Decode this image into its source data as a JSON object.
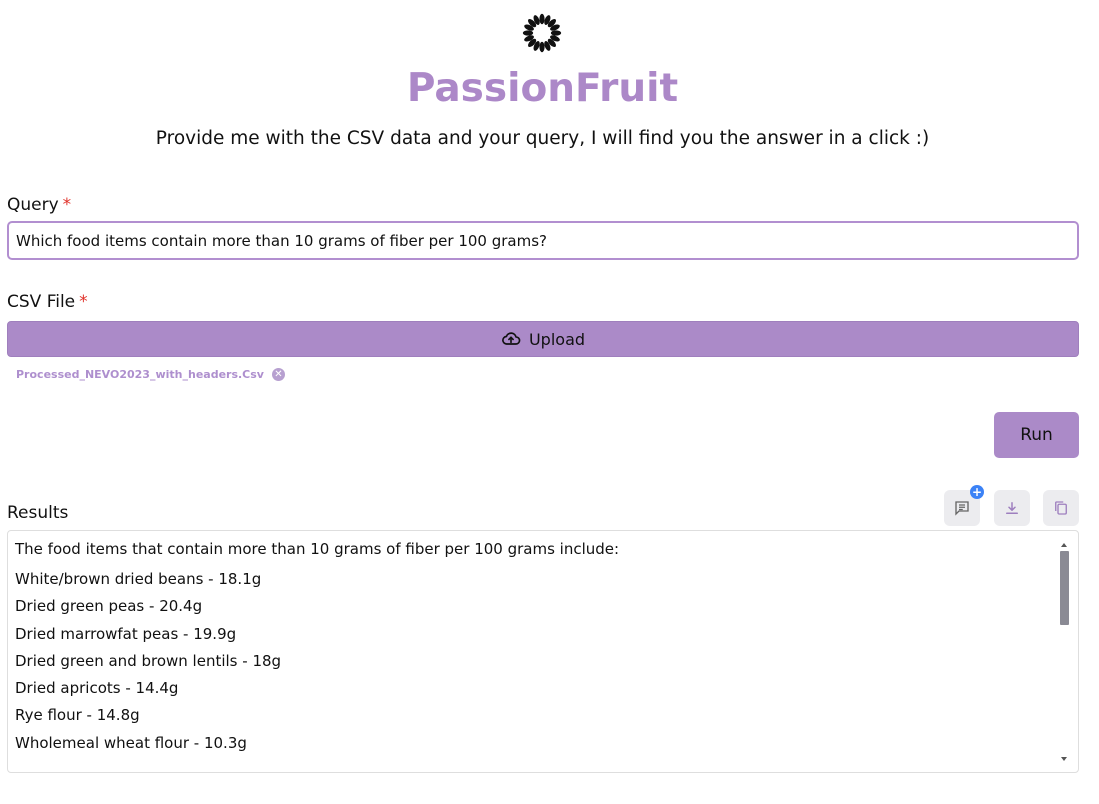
{
  "app": {
    "title": "PassionFruit",
    "subtitle": "Provide me with the CSV data and your query, I will find you the answer in a click :)",
    "logo_icon": "sunburst-logo-icon",
    "accent_color": "#ab8ac8"
  },
  "query": {
    "label": "Query",
    "required_mark": "*",
    "value": "Which food items contain more than 10 grams of fiber per 100 grams?"
  },
  "csv": {
    "label": "CSV File",
    "required_mark": "*",
    "upload_label": "Upload",
    "upload_icon": "cloud-upload-icon",
    "file_name": "Processed_NEVO2023_with_headers.Csv",
    "remove_icon": "close-circle-icon"
  },
  "run": {
    "label": "Run"
  },
  "results": {
    "label": "Results",
    "actions": [
      "comment-icon",
      "download-icon",
      "copy-icon"
    ],
    "badge": "+",
    "intro": "The food items that contain more than 10 grams of fiber per 100 grams include:",
    "lines": [
      "White/brown dried beans - 18.1g",
      "Dried green peas - 20.4g",
      "Dried marrowfat peas - 19.9g",
      "Dried green and brown lentils - 18g",
      "Dried apricots - 14.4g",
      "Rye flour - 14.8g",
      "Wholemeal wheat flour - 10.3g"
    ]
  }
}
